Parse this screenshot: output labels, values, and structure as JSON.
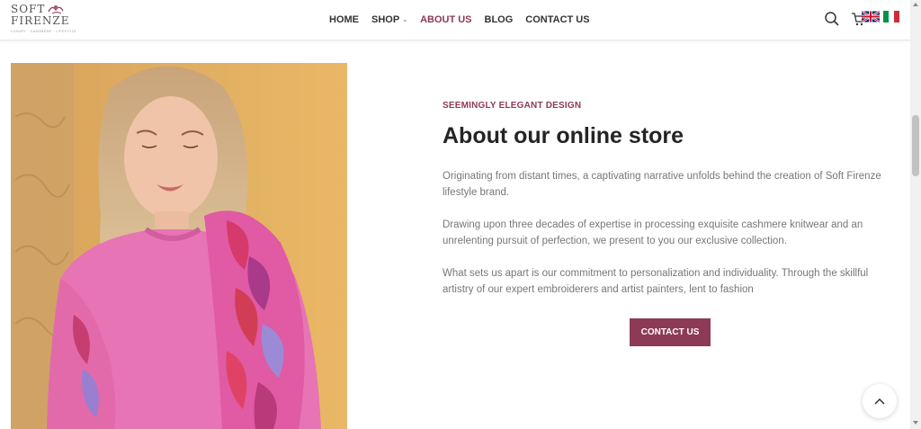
{
  "header": {
    "logo": {
      "line1": "SOFT",
      "line2": "FIRENZE",
      "tagline": "LUXURY · CASHMERE · LIFESTYLE"
    },
    "nav": [
      {
        "label": "HOME"
      },
      {
        "label": "SHOP"
      },
      {
        "label": "ABOUT US"
      },
      {
        "label": "BLOG"
      },
      {
        "label": "CONTACT US"
      }
    ],
    "active_nav": "ABOUT US"
  },
  "main": {
    "eyebrow": "SEEMINGLY ELEGANT DESIGN",
    "title": "About our online store",
    "paragraphs": [
      "Originating from distant times, a captivating narrative unfolds behind the creation of Soft Firenze lifestyle brand.",
      "Drawing upon three decades of expertise in processing exquisite cashmere knitwear and an unrelenting pursuit of perfection, we present to you our exclusive collection.",
      "What sets us apart is our commitment to personalization and individuality. Through the skillful artistry of our expert embroiderers and artist painters, lent to fashion"
    ],
    "cta_label": "CONTACT US"
  },
  "icons": [
    "search-icon",
    "cart-icon",
    "uk-flag-icon",
    "italy-flag-icon",
    "chevron-up-icon"
  ],
  "colors": {
    "accent": "#8c3a55",
    "text_dark": "#242424",
    "text_body": "#777777"
  }
}
